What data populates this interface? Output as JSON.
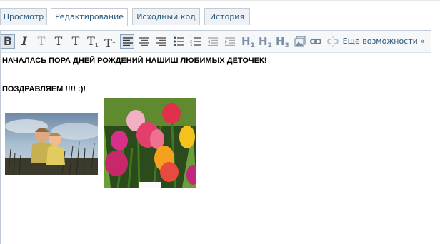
{
  "tabs": [
    {
      "label": "Просмотр",
      "active": false
    },
    {
      "label": "Редактирование",
      "active": true
    },
    {
      "label": "Исходный код",
      "active": false
    },
    {
      "label": "История",
      "active": false
    }
  ],
  "toolbar": {
    "bold": "B",
    "italic": "I",
    "h1": {
      "main": "H",
      "sub": "1"
    },
    "h2": {
      "main": "H",
      "sub": "2"
    },
    "h3": {
      "main": "H",
      "sub": "3"
    },
    "more_label": "Еще возможности »",
    "icons": [
      "bold-icon",
      "italic-icon",
      "plain-text-icon",
      "underline-icon",
      "strikethrough-icon",
      "subscript-icon",
      "superscript-icon",
      "align-left-icon",
      "align-center-icon",
      "align-right-icon",
      "bulleted-list-icon",
      "numbered-list-icon",
      "outdent-icon",
      "indent-icon",
      "heading1-icon",
      "heading2-icon",
      "heading3-icon",
      "insert-image-icon",
      "link-icon",
      "unlink-icon"
    ]
  },
  "content": {
    "line1": "НАЧАЛАСЬ ПОРА ДНЕЙ РОЖДЕНИЙ НАШИШ ЛЮБИМЫХ ДЕТОЧЕК!",
    "line2": "ПОЗДРАВЛЯЕМ !!!! :)!",
    "images": [
      "children-photo",
      "tulips-photo"
    ]
  },
  "colors": {
    "tab_text": "#2b587a",
    "border": "#c3cbd4",
    "toolbar_bg": "#f5f7f9"
  }
}
